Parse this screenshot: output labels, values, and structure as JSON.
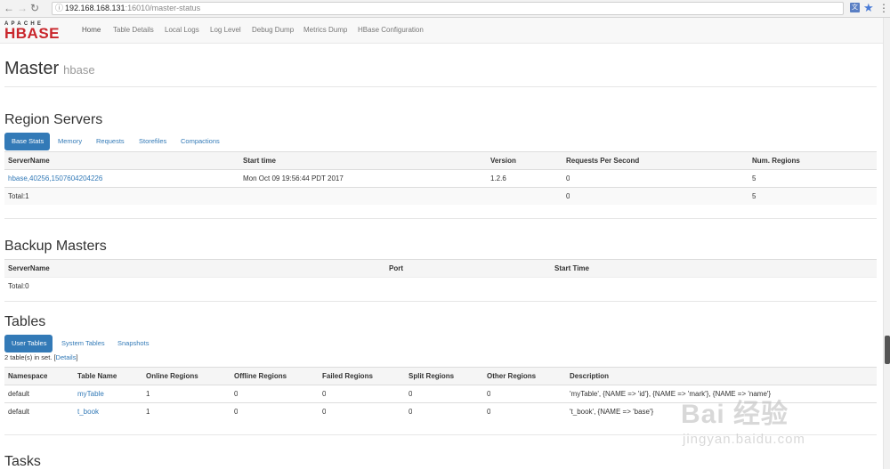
{
  "browser": {
    "url_host": "192.168.168.131",
    "url_path": ":16010/master-status"
  },
  "navbar": {
    "logo_top": "APACHE",
    "logo_main": "HBASE",
    "items": [
      {
        "label": "Home"
      },
      {
        "label": "Table Details"
      },
      {
        "label": "Local Logs"
      },
      {
        "label": "Log Level"
      },
      {
        "label": "Debug Dump"
      },
      {
        "label": "Metrics Dump"
      },
      {
        "label": "HBase Configuration"
      }
    ]
  },
  "header": {
    "title": "Master",
    "subtitle": "hbase"
  },
  "region_servers": {
    "title": "Region Servers",
    "tabs": [
      "Base Stats",
      "Memory",
      "Requests",
      "Storefiles",
      "Compactions"
    ],
    "columns": [
      "ServerName",
      "Start time",
      "Version",
      "Requests Per Second",
      "Num. Regions"
    ],
    "rows": [
      [
        "hbase,40256,1507604204226",
        "Mon Oct 09 19:56:44 PDT 2017",
        "1.2.6",
        "0",
        "5"
      ]
    ],
    "total": [
      "Total:1",
      "",
      "",
      "0",
      "5"
    ]
  },
  "backup_masters": {
    "title": "Backup Masters",
    "columns": [
      "ServerName",
      "Port",
      "Start Time"
    ],
    "total": "Total:0"
  },
  "tables": {
    "title": "Tables",
    "tabs": [
      "User Tables",
      "System Tables",
      "Snapshots"
    ],
    "note_prefix": "2 table(s) in set. [",
    "note_link": "Details",
    "note_suffix": "]",
    "columns": [
      "Namespace",
      "Table Name",
      "Online Regions",
      "Offline Regions",
      "Failed Regions",
      "Split Regions",
      "Other Regions",
      "Description"
    ],
    "rows": [
      [
        "default",
        "myTable",
        "1",
        "0",
        "0",
        "0",
        "0",
        "'myTable', {NAME => 'id'}, {NAME => 'mark'}, {NAME => 'name'}"
      ],
      [
        "default",
        "t_book",
        "1",
        "0",
        "0",
        "0",
        "0",
        "'t_book', {NAME => 'base'}"
      ]
    ]
  },
  "tasks": {
    "title": "Tasks"
  },
  "watermark": {
    "main": "Bai 经验",
    "sub": "jingyan.baidu.com"
  },
  "colors": {
    "link": "#337ab7",
    "logo_red": "#c9262c"
  }
}
